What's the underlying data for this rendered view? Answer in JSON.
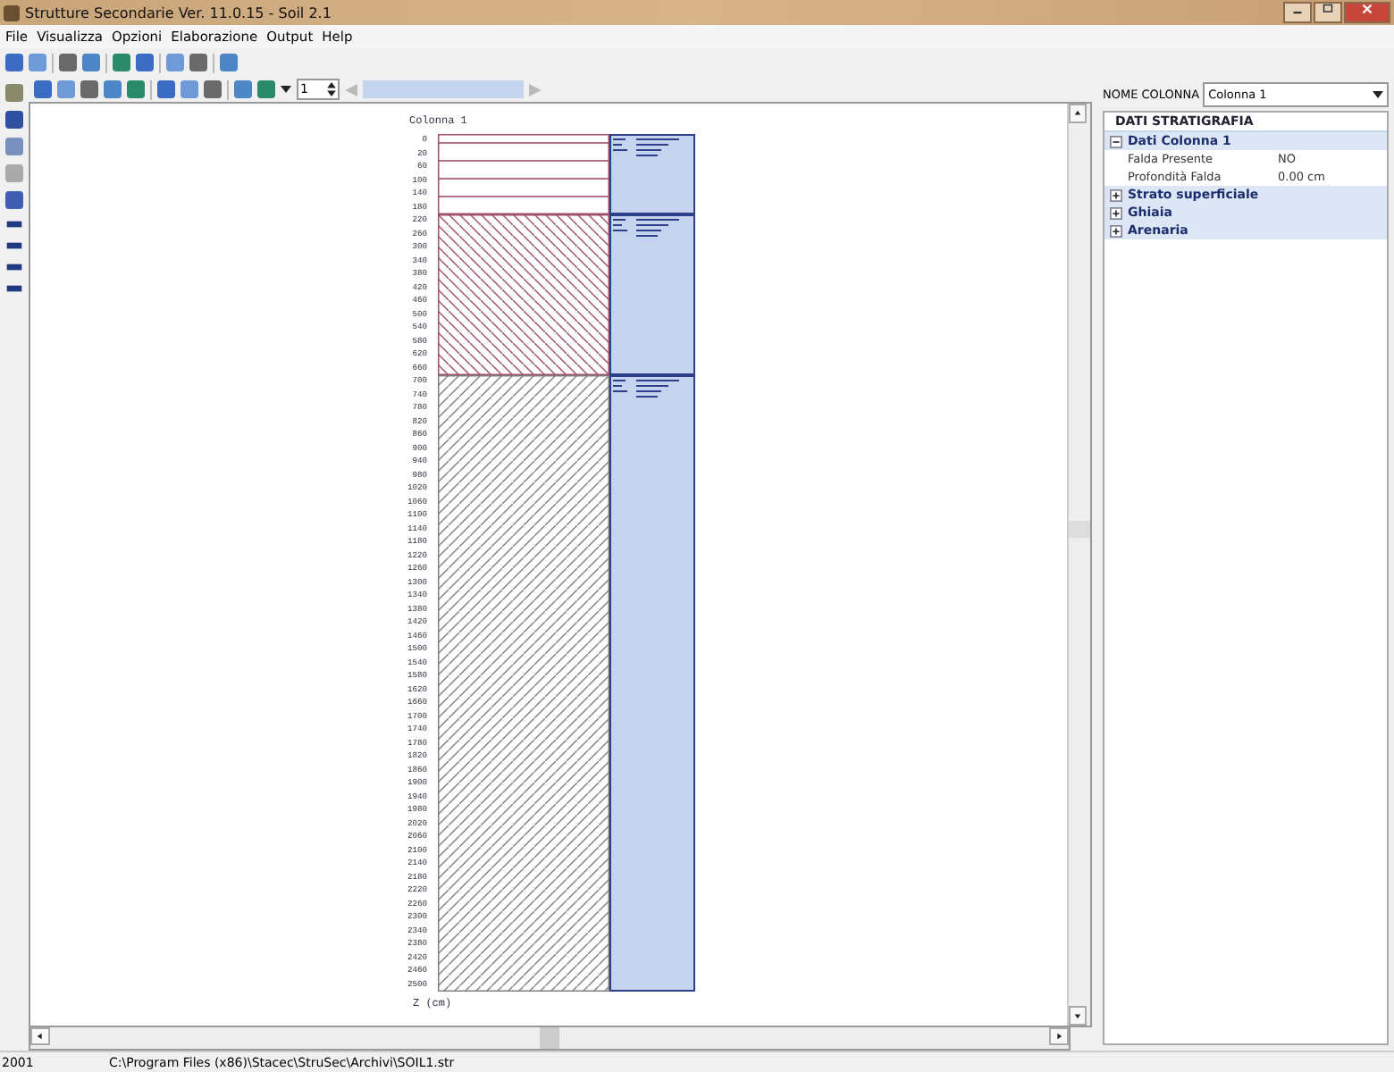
{
  "window": {
    "title": "Strutture Secondarie Ver. 11.0.15 - Soil 2.1"
  },
  "menu": [
    "File",
    "Visualizza",
    "Opzioni",
    "Elaborazione",
    "Output",
    "Help"
  ],
  "page_spinner": {
    "value": "1"
  },
  "drawing": {
    "title": "Colonna 1",
    "axis_label": "Z (cm)",
    "layers": [
      {
        "kind": "horizontal",
        "color": "#a0506a",
        "depths": [
          "0",
          "20",
          "60",
          "100",
          "140",
          "180"
        ]
      },
      {
        "kind": "backslash",
        "color": "#a0506a",
        "depths": [
          "220",
          "260",
          "300",
          "340",
          "380",
          "420",
          "460",
          "500",
          "540",
          "580",
          "620",
          "660"
        ]
      },
      {
        "kind": "slash",
        "color": "#808080",
        "depths": [
          "700",
          "740",
          "780",
          "820",
          "860",
          "900",
          "940",
          "980",
          "1020",
          "1060",
          "1100",
          "1140",
          "1180",
          "1220",
          "1260",
          "1300",
          "1340",
          "1380",
          "1420",
          "1460",
          "1500",
          "1540",
          "1580",
          "1620",
          "1660",
          "1700",
          "1740",
          "1780",
          "1820",
          "1860",
          "1900",
          "1940",
          "1980",
          "2020",
          "2060",
          "2100",
          "2140",
          "2180",
          "2220",
          "2260",
          "2300",
          "2340",
          "2380",
          "2420",
          "2460",
          "2500"
        ]
      }
    ]
  },
  "property_panel": {
    "name_label": "NOME COLONNA",
    "name_value": "Colonna 1",
    "header": "DATI STRATIGRAFIA",
    "sections": [
      {
        "title": "Dati Colonna 1",
        "expanded": true,
        "children": [
          {
            "name": "Falda Presente",
            "value": "NO"
          },
          {
            "name": "Profondità Falda",
            "value": "0.00 cm"
          }
        ]
      },
      {
        "title": "Strato superficiale",
        "expanded": false
      },
      {
        "title": "Ghiaia",
        "expanded": false
      },
      {
        "title": "Arenaria",
        "expanded": false
      }
    ]
  },
  "status_bar": {
    "code": "2001",
    "path": "C:\\Program Files (x86)\\Stacec\\StruSec\\Archivi\\SOIL1.str"
  }
}
